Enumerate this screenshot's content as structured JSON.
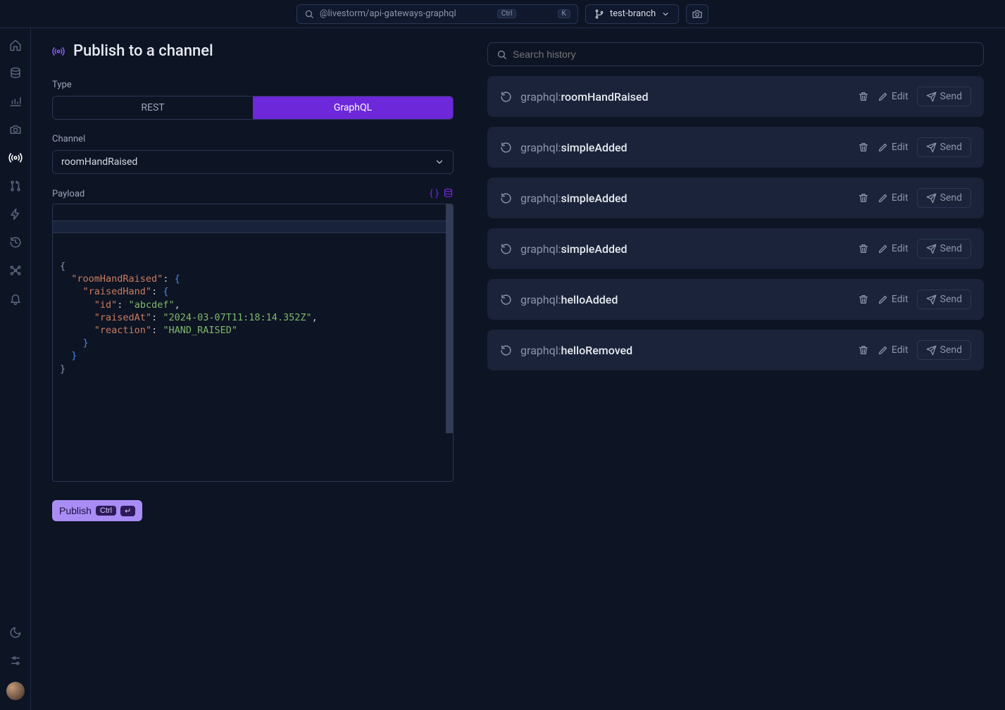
{
  "topbar": {
    "search_text": "@livestorm/api-gateways-graphql",
    "kbd1": "Ctrl",
    "kbd2": "K",
    "branch": "test-branch"
  },
  "page": {
    "title": "Publish to a channel"
  },
  "type": {
    "label": "Type",
    "rest": "REST",
    "graphql": "GraphQL",
    "active": "graphql"
  },
  "channel": {
    "label": "Channel",
    "value": "roomHandRaised"
  },
  "payload": {
    "label": "Payload",
    "code": {
      "k1": "\"roomHandRaised\"",
      "k2": "\"raisedHand\"",
      "k3": "\"id\"",
      "v3": "\"abcdef\"",
      "k4": "\"raisedAt\"",
      "v4": "\"2024-03-07T11:18:14.352Z\"",
      "k5": "\"reaction\"",
      "v5": "\"HAND_RAISED\""
    }
  },
  "publish": {
    "label": "Publish",
    "kbd1": "Ctrl",
    "kbd2": "↵"
  },
  "history": {
    "search_placeholder": "Search history",
    "edit_label": "Edit",
    "send_label": "Send",
    "items": [
      {
        "proto": "graphql:",
        "name": "roomHandRaised"
      },
      {
        "proto": "graphql:",
        "name": "simpleAdded"
      },
      {
        "proto": "graphql:",
        "name": "simpleAdded"
      },
      {
        "proto": "graphql:",
        "name": "simpleAdded"
      },
      {
        "proto": "graphql:",
        "name": "helloAdded"
      },
      {
        "proto": "graphql:",
        "name": "helloRemoved"
      }
    ]
  }
}
